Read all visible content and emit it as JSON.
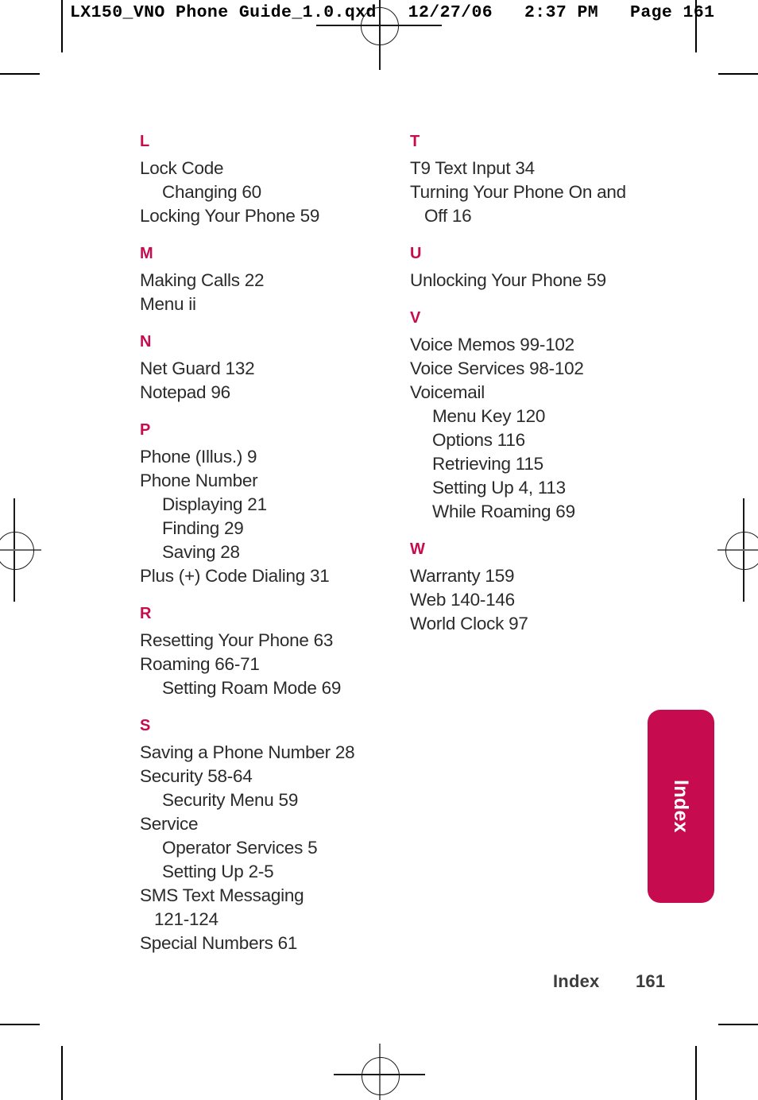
{
  "prepress": {
    "slug": "LX150_VNO Phone Guide_1.0.qxd   12/27/06   2:37 PM   Page 161"
  },
  "colors": {
    "accent": "#c60b4e",
    "body_text": "#2b2b2b",
    "folio_text": "#3d3d3d"
  },
  "thumb_tab": {
    "label": "Index"
  },
  "footer": {
    "label": "Index",
    "page_number": "161"
  },
  "index": {
    "left_column": [
      {
        "letter": "L",
        "entries": [
          {
            "text": "Lock Code",
            "level": 0
          },
          {
            "text": "Changing 60",
            "level": 1
          },
          {
            "text": "Locking Your Phone 59",
            "level": 0
          }
        ]
      },
      {
        "letter": "M",
        "entries": [
          {
            "text": "Making Calls 22",
            "level": 0
          },
          {
            "text": "Menu ii",
            "level": 0
          }
        ]
      },
      {
        "letter": "N",
        "entries": [
          {
            "text": "Net Guard 132",
            "level": 0
          },
          {
            "text": "Notepad 96",
            "level": 0
          }
        ]
      },
      {
        "letter": "P",
        "entries": [
          {
            "text": "Phone (Illus.) 9",
            "level": 0
          },
          {
            "text": "Phone Number",
            "level": 0
          },
          {
            "text": "Displaying 21",
            "level": 1
          },
          {
            "text": "Finding 29",
            "level": 1
          },
          {
            "text": "Saving 28",
            "level": 1
          },
          {
            "text": "Plus (+) Code Dialing 31",
            "level": 0
          }
        ]
      },
      {
        "letter": "R",
        "entries": [
          {
            "text": "Resetting Your Phone 63",
            "level": 0
          },
          {
            "text": "Roaming 66-71",
            "level": 0
          },
          {
            "text": "Setting Roam Mode 69",
            "level": 1
          }
        ]
      },
      {
        "letter": "S",
        "entries": [
          {
            "text": "Saving a Phone Number 28",
            "level": 0
          },
          {
            "text": "Security 58-64",
            "level": 0
          },
          {
            "text": "Security Menu 59",
            "level": 1
          },
          {
            "text": "Service",
            "level": 0
          },
          {
            "text": "Operator Services 5",
            "level": 1
          },
          {
            "text": "Setting Up 2-5",
            "level": 1
          },
          {
            "text": "SMS Text Messaging\n121-124",
            "level": 2
          },
          {
            "text": "Special Numbers 61",
            "level": 0
          }
        ]
      }
    ],
    "right_column": [
      {
        "letter": "T",
        "entries": [
          {
            "text": "T9 Text Input 34",
            "level": 0
          },
          {
            "text": "Turning Your Phone On and\nOff 16",
            "level": 2
          }
        ]
      },
      {
        "letter": "U",
        "entries": [
          {
            "text": "Unlocking Your Phone 59",
            "level": 0
          }
        ]
      },
      {
        "letter": "V",
        "entries": [
          {
            "text": "Voice Memos 99-102",
            "level": 0
          },
          {
            "text": "Voice Services 98-102",
            "level": 0
          },
          {
            "text": "Voicemail",
            "level": 0
          },
          {
            "text": "Menu Key 120",
            "level": 1
          },
          {
            "text": "Options 116",
            "level": 1
          },
          {
            "text": "Retrieving 115",
            "level": 1
          },
          {
            "text": "Setting Up 4, 113",
            "level": 1
          },
          {
            "text": "While Roaming 69",
            "level": 1
          }
        ]
      },
      {
        "letter": "W",
        "entries": [
          {
            "text": "Warranty 159",
            "level": 0
          },
          {
            "text": "Web 140-146",
            "level": 0
          },
          {
            "text": "World Clock 97",
            "level": 0
          }
        ]
      }
    ]
  }
}
